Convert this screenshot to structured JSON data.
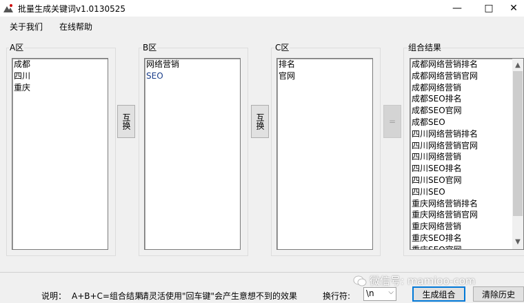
{
  "window": {
    "title": "批量生成关键词v1.0130525",
    "minimize_glyph": "—",
    "maximize_glyph": "□",
    "close_glyph": "✕"
  },
  "menu": {
    "about": "关于我们",
    "help": "在线帮助"
  },
  "groups": {
    "a": {
      "label": "A区",
      "items": [
        "成都",
        "四川",
        "重庆"
      ]
    },
    "b": {
      "label": "B区",
      "items": [
        "网络营销",
        "SEO"
      ]
    },
    "c": {
      "label": "C区",
      "items": [
        "排名",
        "官网"
      ]
    },
    "result": {
      "label": "组合结果",
      "items": [
        "成都网络营销排名",
        "成都网络营销官网",
        "成都网络营销",
        "成都SEO排名",
        "成都SEO官网",
        "成都SEO",
        "四川网络营销排名",
        "四川网络营销官网",
        "四川网络营销",
        "四川SEO排名",
        "四川SEO官网",
        "四川SEO",
        "重庆网络营销排名",
        "重庆网络营销官网",
        "重庆网络营销",
        "重庆SEO排名",
        "重庆SEO官网"
      ]
    }
  },
  "buttons": {
    "swap_ab": "互换",
    "swap_bc": "互换",
    "equals": "=",
    "generate": "生成组合",
    "clear_history": "清除历史"
  },
  "footer": {
    "explain_label": "说明：",
    "explain_formula": "A+B+C=组合结果",
    "explain_tip": "请灵活使用\"回车键\"会产生意想不到的效果",
    "separator_label": "换行符:",
    "separator_value": "\\n",
    "watermark": "微信号: mamioo-com"
  },
  "icons": {
    "scroll_up": "scroll-up-arrow-icon",
    "scroll_down": "scroll-down-arrow-icon",
    "dropdown": "chevron-down-icon",
    "app": "app-icon",
    "wechat": "wechat-icon"
  },
  "colors": {
    "window_bg": "#f0f0f0",
    "titlebar_bg": "#ffffff",
    "focus_border": "#0078d7"
  }
}
